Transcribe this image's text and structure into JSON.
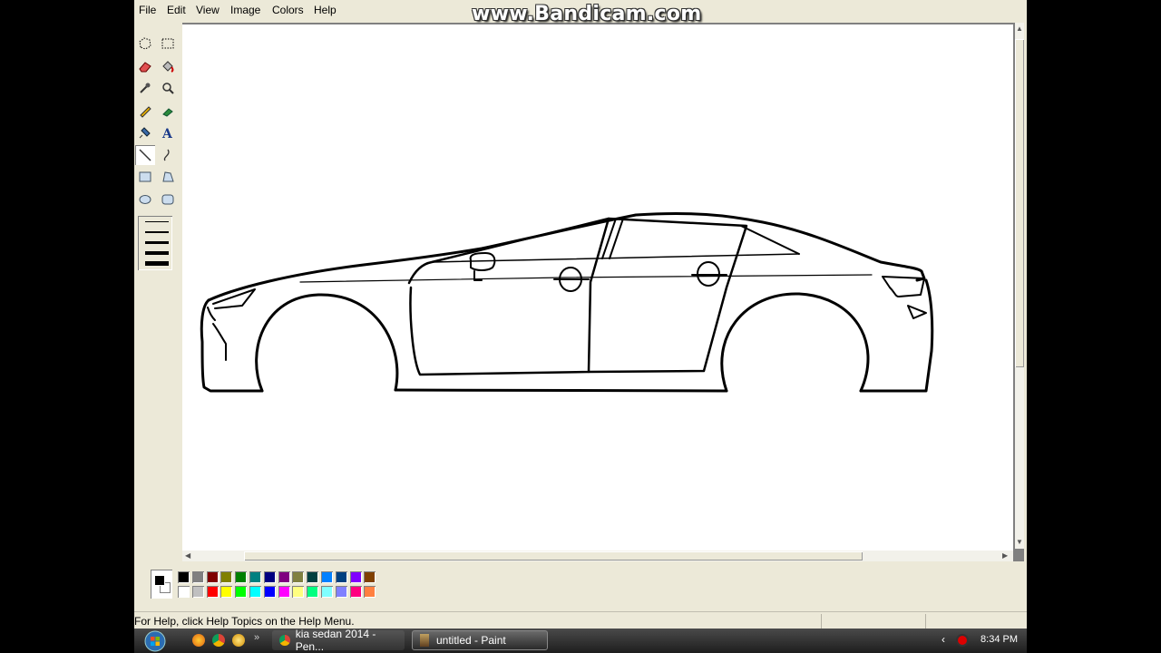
{
  "menu": [
    "File",
    "Edit",
    "View",
    "Image",
    "Colors",
    "Help"
  ],
  "watermark": "www.Bandicam.com",
  "tools": [
    {
      "name": "free-form-select-tool",
      "icon": "free-select-icon"
    },
    {
      "name": "select-tool",
      "icon": "rect-select-icon"
    },
    {
      "name": "eraser-tool",
      "icon": "eraser-icon"
    },
    {
      "name": "fill-tool",
      "icon": "fill-bucket-icon"
    },
    {
      "name": "pick-color-tool",
      "icon": "eyedropper-icon"
    },
    {
      "name": "magnifier-tool",
      "icon": "magnifier-icon"
    },
    {
      "name": "pencil-tool",
      "icon": "pencil-icon"
    },
    {
      "name": "brush-tool",
      "icon": "brush-icon"
    },
    {
      "name": "airbrush-tool",
      "icon": "airbrush-icon"
    },
    {
      "name": "text-tool",
      "icon": "text-icon"
    },
    {
      "name": "line-tool",
      "icon": "line-icon",
      "selected": true
    },
    {
      "name": "curve-tool",
      "icon": "curve-icon"
    },
    {
      "name": "rectangle-tool",
      "icon": "rectangle-icon"
    },
    {
      "name": "polygon-tool",
      "icon": "polygon-icon"
    },
    {
      "name": "ellipse-tool",
      "icon": "ellipse-icon"
    },
    {
      "name": "rounded-rectangle-tool",
      "icon": "rounded-rectangle-icon"
    }
  ],
  "colors": {
    "foreground": "#000000",
    "background": "#ffffff",
    "row1": [
      "#000000",
      "#808080",
      "#800000",
      "#808000",
      "#008000",
      "#008080",
      "#000080",
      "#800080",
      "#808040",
      "#004040",
      "#0080ff",
      "#004080",
      "#8000ff",
      "#804000"
    ],
    "row2": [
      "#ffffff",
      "#c0c0c0",
      "#ff0000",
      "#ffff00",
      "#00ff00",
      "#00ffff",
      "#0000ff",
      "#ff00ff",
      "#ffff80",
      "#00ff80",
      "#80ffff",
      "#8080ff",
      "#ff0080",
      "#ff8040"
    ]
  },
  "status": {
    "help_text": "For Help, click Help Topics on the Help Menu."
  },
  "taskbar": {
    "tasks": [
      {
        "label": "kia sedan 2014 - Pen..."
      },
      {
        "label": "untitled - Paint"
      }
    ],
    "clock": "8:34 PM"
  }
}
